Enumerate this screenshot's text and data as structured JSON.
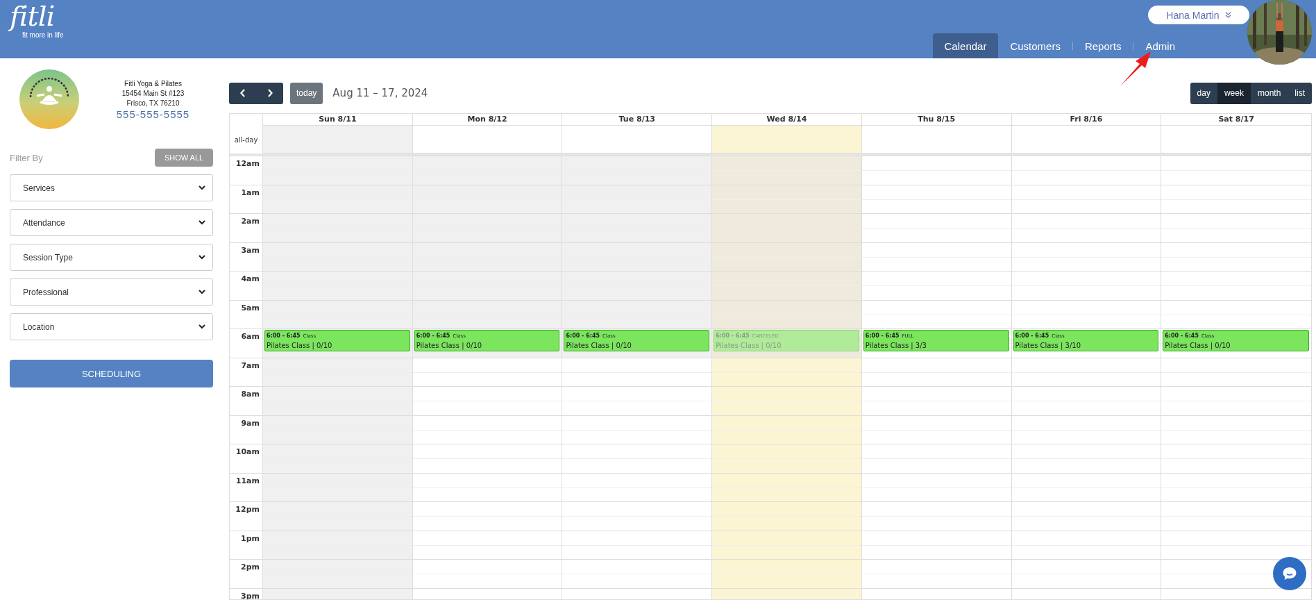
{
  "header": {
    "logo": "fitli",
    "tagline": "fit more in life",
    "user": "Hana Martin",
    "nav": [
      {
        "label": "Calendar",
        "selected": true
      },
      {
        "label": "Customers",
        "selected": false
      },
      {
        "label": "Reports",
        "selected": false
      },
      {
        "label": "Admin",
        "selected": false
      }
    ]
  },
  "studio": {
    "name": "Fitli Yoga & Pilates",
    "street": "15454 Main St #123",
    "city": "Frisco, TX 76210",
    "phone": "555-555-5555"
  },
  "filter": {
    "title": "Filter By",
    "show_all": "SHOW ALL",
    "selects": [
      "Services",
      "Attendance",
      "Session Type",
      "Professional",
      "Location"
    ],
    "action": "SCHEDULING"
  },
  "toolbar": {
    "today": "today",
    "range": "Aug 11 – 17, 2024",
    "views": [
      {
        "label": "day",
        "selected": false
      },
      {
        "label": "week",
        "selected": true
      },
      {
        "label": "month",
        "selected": false
      },
      {
        "label": "list",
        "selected": false
      }
    ]
  },
  "calendar": {
    "all_day": "all-day",
    "days": [
      {
        "label": "Sun 8/11",
        "kind": "closed",
        "today": false
      },
      {
        "label": "Mon 8/12",
        "kind": "early",
        "today": false
      },
      {
        "label": "Tue 8/13",
        "kind": "early",
        "today": false
      },
      {
        "label": "Wed 8/14",
        "kind": "early",
        "today": true
      },
      {
        "label": "Thu 8/15",
        "kind": "open",
        "today": false
      },
      {
        "label": "Fri 8/16",
        "kind": "open",
        "today": false
      },
      {
        "label": "Sat 8/17",
        "kind": "open",
        "today": false
      }
    ],
    "hours": [
      {
        "label": "12am"
      },
      {
        "label": "1am"
      },
      {
        "label": "2am"
      },
      {
        "label": "3am"
      },
      {
        "label": "4am"
      },
      {
        "label": "5am"
      },
      {
        "label": "6am",
        "events": [
          {
            "time": "6:00 - 6:45",
            "tag": "Class",
            "title": "Pilates Class | 0/10",
            "canceled": false
          },
          {
            "time": "6:00 - 6:45",
            "tag": "Class",
            "title": "Pilates Class | 0/10",
            "canceled": false
          },
          {
            "time": "6:00 - 6:45",
            "tag": "Class",
            "title": "Pilates Class | 0/10",
            "canceled": false
          },
          {
            "time": "6:00 - 6:45",
            "tag": "CANCELED",
            "title": "Pilates Class | 0/10",
            "canceled": true
          },
          {
            "time": "6:00 - 6:45",
            "tag": "FULL",
            "title": "Pilates Class | 3/3",
            "canceled": false
          },
          {
            "time": "6:00 - 6:45",
            "tag": "Class",
            "title": "Pilates Class | 3/10",
            "canceled": false
          },
          {
            "time": "6:00 - 6:45",
            "tag": "Class",
            "title": "Pilates Class | 0/10",
            "canceled": false
          }
        ]
      },
      {
        "label": "7am"
      },
      {
        "label": "8am"
      },
      {
        "label": "9am"
      },
      {
        "label": "10am"
      },
      {
        "label": "11am"
      },
      {
        "label": "12pm"
      },
      {
        "label": "1pm"
      },
      {
        "label": "2pm"
      },
      {
        "label": "3pm"
      }
    ]
  }
}
